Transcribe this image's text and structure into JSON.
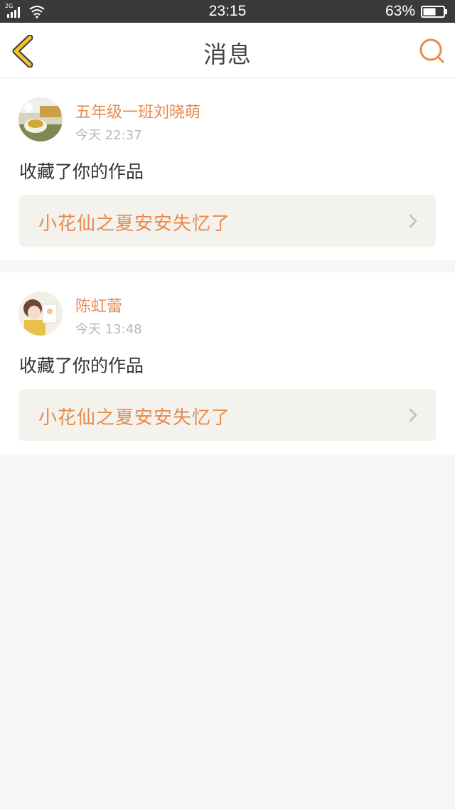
{
  "status_bar": {
    "network": "2G",
    "time": "23:15",
    "battery_percent": "63%",
    "battery_level": 0.63,
    "icons": [
      "signal-icon",
      "wifi-icon",
      "battery-icon"
    ]
  },
  "nav": {
    "title": "消息",
    "back_icon": "chevron-left-icon",
    "search_icon": "search-icon",
    "accent_color": "#e88a4e",
    "back_icon_color": "#f2c230"
  },
  "messages": [
    {
      "user": "五年级一班刘晓萌",
      "time": "今天 22:37",
      "action": "收藏了你的作品",
      "work_title": "小花仙之夏安安失忆了"
    },
    {
      "user": "陈虹蕾",
      "time": "今天 13:48",
      "action": "收藏了你的作品",
      "work_title": "小花仙之夏安安失忆了"
    }
  ]
}
